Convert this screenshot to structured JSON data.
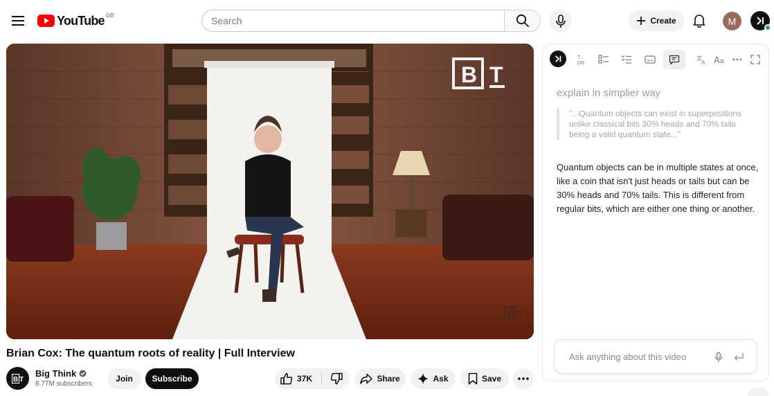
{
  "header": {
    "logo_text": "YouTube",
    "region": "GB",
    "search_placeholder": "Search",
    "create_label": "Create",
    "avatar_letter": "M"
  },
  "video": {
    "title": "Brian Cox: The quantum roots of reality | Full Interview",
    "watermark_letters": "B T"
  },
  "channel": {
    "name": "Big Think",
    "subscribers": "8.77M subscribers",
    "join_label": "Join",
    "subscribe_label": "Subscribe"
  },
  "actions": {
    "like_count": "37K",
    "share_label": "Share",
    "ask_label": "Ask",
    "save_label": "Save"
  },
  "panel": {
    "toolbar_icons": [
      "extension-logo-icon",
      "translate-dr-icon",
      "summary-list-icon",
      "checklist-icon",
      "captions-icon",
      "chat-icon",
      "language-icon",
      "font-size-icon",
      "more-horizontal-icon",
      "fullscreen-icon"
    ],
    "prompt": "explain in simplier way",
    "quote": "\"...Quantum objects can exist in superpositions unlike classical bits 30% heads and 70% tails being a valid quantum state...\"",
    "answer": "Quantum objects can be in multiple states at once, like a coin that isn't just heads or tails but can be 30% heads and 70% tails. This is different from regular bits, which are either one thing or another.",
    "input_placeholder": "Ask anything about this video"
  },
  "colors": {
    "youtube_red": "#ff0000",
    "subscribe_bg": "#0f0f0f",
    "pill_bg": "#f2f2f2",
    "status_green": "#2ba640"
  }
}
